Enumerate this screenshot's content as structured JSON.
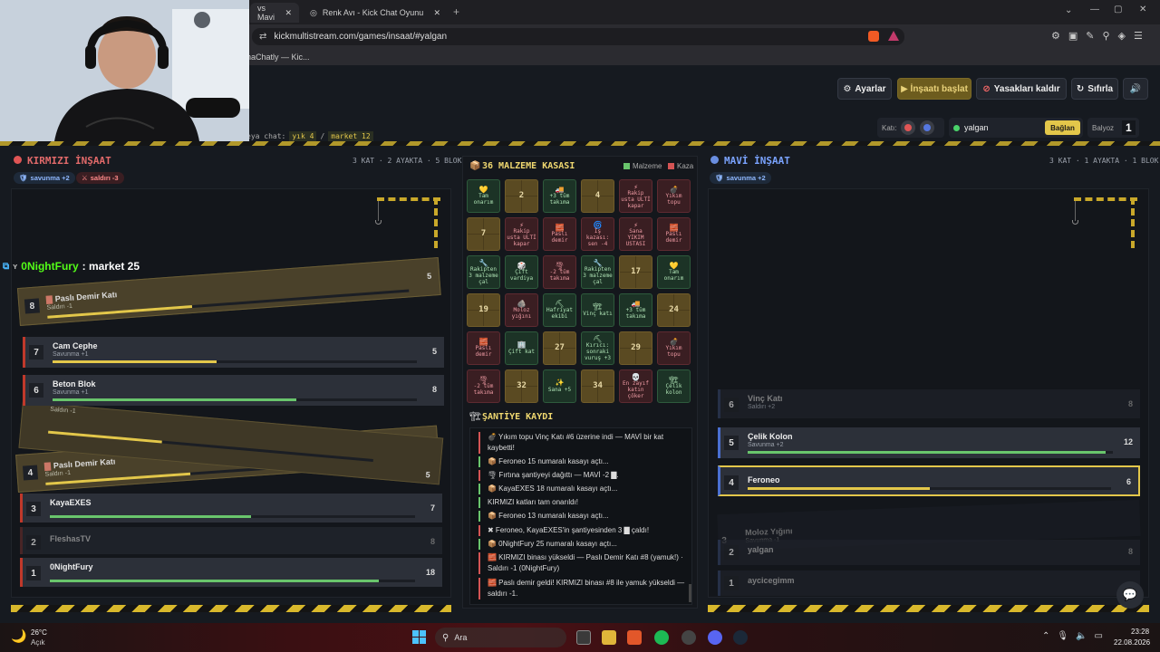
{
  "browser": {
    "tabs": [
      {
        "label": "vs Mavi"
      },
      {
        "label": "Renk Avı - Kick Chat Oyunu"
      }
    ],
    "url": "kickmultistream.com/games/insaat/#yalgan",
    "bookmark": "haChatly — Kic..."
  },
  "toolbar": {
    "settings": "Ayarlar",
    "start": "▶ İnşaatı başlat",
    "unban": "Yasakları kaldır",
    "reset": "Sıfırla",
    "chat_hint": "eya chat:",
    "cmd1": "yık 4",
    "sep": "/",
    "cmd2": "market 12",
    "floor_label": "Katı:",
    "channel": "yalgan",
    "connect": "Bağlan",
    "hammer_label": "Balyoz",
    "hammer_count": "1"
  },
  "red": {
    "title": "KIRMIZI İNŞAAT",
    "stats": "3 KAT · 2 AYAKTA · 5 BLOK",
    "badge1": "savunma +2",
    "badge2": "saldırı -3",
    "chat_user": "0NightFury",
    "chat_msg": ": market 25",
    "falling1": {
      "num": "8",
      "name": "Paslı Demir Katı",
      "sub": "Saldırı -1",
      "val": "5"
    },
    "falling2": {
      "num": "4",
      "name": "Paslı Demir Katı",
      "sub": "Saldırı -1",
      "val": "5"
    },
    "falling_ghost": "Saldırı -1",
    "floors": [
      {
        "num": "7",
        "name": "Cam Cephe",
        "sub": "Savunma +1",
        "val": "5",
        "pct": 0.45
      },
      {
        "num": "6",
        "name": "Beton Blok",
        "sub": "Savunma +1",
        "val": "8",
        "pct": 0.67
      },
      {
        "num": "3",
        "name": "KayaEXES",
        "sub": "",
        "val": "7",
        "pct": 0.55
      },
      {
        "num": "2",
        "name": "FleshasTV",
        "sub": "",
        "val": "8",
        "pct": 0
      },
      {
        "num": "1",
        "name": "0NightFury",
        "sub": "",
        "val": "18",
        "pct": 0.9
      }
    ]
  },
  "blue": {
    "title": "MAVİ İNŞAAT",
    "stats": "3 KAT · 1 AYAKTA · 1 BLOK",
    "badge1": "savunma +2",
    "floors": [
      {
        "num": "6",
        "name": "Vinç Katı",
        "sub": "Saldırı +2",
        "val": "8",
        "pct": 0
      },
      {
        "num": "5",
        "name": "Çelik Kolon",
        "sub": "Savunma +2",
        "val": "12",
        "pct": 0.98
      },
      {
        "num": "4",
        "name": "Feroneo",
        "sub": "",
        "val": "6",
        "pct": 0.5
      },
      {
        "num": "3",
        "name": "Moloz Yığını",
        "sub": "Savunma -1",
        "val": "",
        "pct": 0
      },
      {
        "num": "2",
        "name": "yalgan",
        "sub": "",
        "val": "8",
        "pct": 0
      },
      {
        "num": "1",
        "name": "aycicegimm",
        "sub": "",
        "val": "",
        "pct": 0
      }
    ]
  },
  "chest": {
    "title": "36 MALZEME KASASI",
    "legend_good": "Malzeme",
    "legend_bad": "Kaza",
    "cells": [
      {
        "t": "g",
        "icon": "💛",
        "text": "Tam onarım"
      },
      {
        "t": "n",
        "text": "2"
      },
      {
        "t": "g",
        "icon": "🚚",
        "text": "+3 tüm takıma"
      },
      {
        "t": "n",
        "text": "4"
      },
      {
        "t": "b",
        "icon": "⚡",
        "text": "Rakip usta ULTİ kapar"
      },
      {
        "t": "b",
        "icon": "💣",
        "text": "Yıkım topu"
      },
      {
        "t": "n",
        "text": "7"
      },
      {
        "t": "b",
        "icon": "⚡",
        "text": "Rakip usta ULTİ kapar"
      },
      {
        "t": "b",
        "icon": "🧱",
        "text": "Paslı demir"
      },
      {
        "t": "b",
        "icon": "🌀",
        "text": "İş kazası: sen -4"
      },
      {
        "t": "b",
        "icon": "⚡",
        "text": "Sana YIKIM USTASI"
      },
      {
        "t": "b",
        "icon": "🧱",
        "text": "Paslı demir"
      },
      {
        "t": "g",
        "icon": "🔧",
        "text": "Rakipten 3 malzeme çal"
      },
      {
        "t": "g",
        "icon": "🎲",
        "text": "Çift vardiya"
      },
      {
        "t": "b",
        "icon": "🌪",
        "text": "-2 tüm takıma"
      },
      {
        "t": "g",
        "icon": "🔧",
        "text": "Rakipten 3 malzeme çal"
      },
      {
        "t": "n",
        "text": "17"
      },
      {
        "t": "g",
        "icon": "💛",
        "text": "Tam onarım"
      },
      {
        "t": "n",
        "text": "19"
      },
      {
        "t": "b",
        "icon": "🪨",
        "text": "Moloz yığını"
      },
      {
        "t": "g",
        "icon": "⛏",
        "text": "Hafriyat ekibi"
      },
      {
        "t": "g",
        "icon": "🏗",
        "text": "Vinç katı"
      },
      {
        "t": "g",
        "icon": "🚚",
        "text": "+3 tüm takıma"
      },
      {
        "t": "n",
        "text": "24"
      },
      {
        "t": "b",
        "icon": "🧱",
        "text": "Paslı demir"
      },
      {
        "t": "g",
        "icon": "🏢",
        "text": "Çift kat"
      },
      {
        "t": "n",
        "text": "27"
      },
      {
        "t": "g",
        "icon": "⛏",
        "text": "Kırıcı: sonraki vuruş +3"
      },
      {
        "t": "n",
        "text": "29"
      },
      {
        "t": "b",
        "icon": "💣",
        "text": "Yıkım topu"
      },
      {
        "t": "b",
        "icon": "🌪",
        "text": "-2 tüm takıma"
      },
      {
        "t": "n",
        "text": "32"
      },
      {
        "t": "g",
        "icon": "✨",
        "text": "Sana +5"
      },
      {
        "t": "n",
        "text": "34"
      },
      {
        "t": "b",
        "icon": "💀",
        "text": "En zayıf katın çöker"
      },
      {
        "t": "g",
        "icon": "🏗",
        "text": "Çelik kolon"
      }
    ]
  },
  "log": {
    "title": "ŞANTİYE KAYDI",
    "lines": [
      {
        "c": "#d45454",
        "text": "💣 Yıkım topu Vinç Katı #6 üzerine indi — MAVİ bir kat kaybetti!"
      },
      {
        "c": "#69c56c",
        "text": "📦 Feroneo 15 numaralı kasayı açtı..."
      },
      {
        "c": "#d45454",
        "text": "🌪 Fırtına şantiyeyi dağıttı — MAVİ -2 ▇."
      },
      {
        "c": "#69c56c",
        "text": "📦 KayaEXES 18 numaralı kasayı açtı..."
      },
      {
        "c": "#69c56c",
        "text": "KIRMIZI katları tam onarıldı!"
      },
      {
        "c": "#69c56c",
        "text": "📦 Feroneo 13 numaralı kasayı açtı..."
      },
      {
        "c": "#d45454",
        "text": "✖ Feroneo, KayaEXES'in şantiyesinden 3 ▇ çaldı!"
      },
      {
        "c": "#69c56c",
        "text": "📦 0NightFury 25 numaralı kasayı açtı..."
      },
      {
        "c": "#d45454",
        "text": "🧱 KIRMIZI binası yükseldi — Paslı Demir Katı #8 (yamuk!) · Saldırı -1 (0NightFury)"
      },
      {
        "c": "#d45454",
        "text": "🧱 Paslı demir geldi! KIRMIZI binası #8 ile yamuk yükseldi — saldırı -1."
      }
    ]
  },
  "taskbar": {
    "temp": "26°C",
    "weather": "Açık",
    "search": "Ara",
    "time": "23:28",
    "date": "22.08.2026"
  }
}
